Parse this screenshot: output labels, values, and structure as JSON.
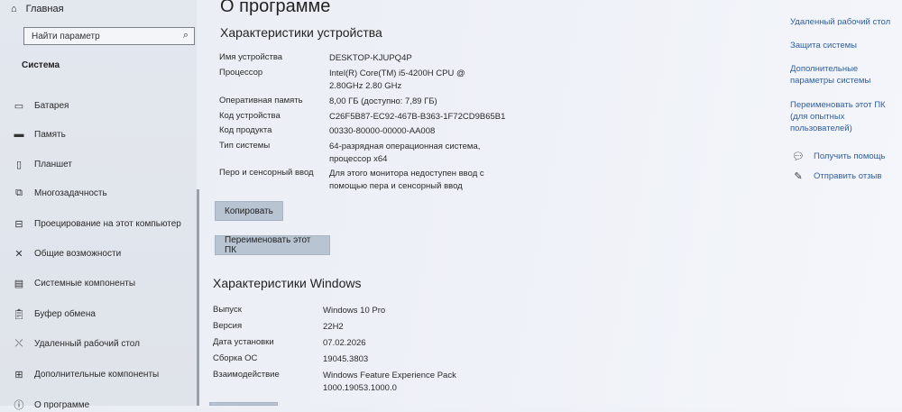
{
  "sidebar": {
    "home_label": "Главная",
    "search_placeholder": "Найти параметр",
    "section_title": "Система",
    "items": [
      {
        "label": "Батарея",
        "icon": "battery-icon"
      },
      {
        "label": "Память",
        "icon": "storage-icon"
      },
      {
        "label": "Планшет",
        "icon": "tablet-icon"
      },
      {
        "label": "Многозадачность",
        "icon": "multitasking-icon"
      },
      {
        "label": "Проецирование на этот компьютер",
        "icon": "projecting-icon"
      },
      {
        "label": "Общие возможности",
        "icon": "shared-experiences-icon"
      },
      {
        "label": "Системные компоненты",
        "icon": "system-components-icon"
      },
      {
        "label": "Буфер обмена",
        "icon": "clipboard-icon"
      },
      {
        "label": "Удаленный рабочий стол",
        "icon": "remote-desktop-icon"
      },
      {
        "label": "Дополнительные компоненты",
        "icon": "optional-features-icon"
      },
      {
        "label": "О программе",
        "icon": "info-icon"
      }
    ]
  },
  "main": {
    "page_title": "О программе",
    "device_specs_title": "Характеристики устройства",
    "device_specs": [
      {
        "key": "Имя устройства",
        "value": "DESKTOP-KJUPQ4P"
      },
      {
        "key": "Процессор",
        "value": "Intel(R) Core(TM) i5-4200H CPU @ 2.80GHz   2.80 GHz"
      },
      {
        "key": "Оперативная память",
        "value": "8,00 ГБ (доступно: 7,89 ГБ)"
      },
      {
        "key": "Код устройства",
        "value": "C26F5B87-EC92-467B-B363-1F72CD9B65B1"
      },
      {
        "key": "Код продукта",
        "value": "00330-80000-00000-AA008"
      },
      {
        "key": "Тип системы",
        "value": "64-разрядная операционная система, процессор x64"
      },
      {
        "key": "Перо и сенсорный ввод",
        "value": "Для этого монитора недоступен ввод с помощью пера и сенсорный ввод"
      }
    ],
    "copy_button": "Копировать",
    "rename_button": "Переименовать этот ПК",
    "windows_specs_title": "Характеристики Windows",
    "windows_specs": [
      {
        "key": "Выпуск",
        "value": "Windows 10 Pro"
      },
      {
        "key": "Версия",
        "value": "22H2"
      },
      {
        "key": "Дата установки",
        "value": "07.02.2026"
      },
      {
        "key": "Сборка ОС",
        "value": "19045.3803"
      },
      {
        "key": "Взаимодействие",
        "value": "Windows Feature Experience Pack 1000.19053.1000.0"
      }
    ]
  },
  "right_panel": {
    "links": [
      "Удаленный рабочий стол",
      "Защита системы",
      "Дополнительные параметры системы",
      "Переименовать этот ПК (для опытных пользователей)"
    ],
    "help": [
      {
        "label": "Получить помощь",
        "icon": "help-chat-icon"
      },
      {
        "label": "Отправить отзыв",
        "icon": "feedback-icon"
      }
    ]
  },
  "colors": {
    "link": "#2f5fa0",
    "button_bg": "#b9c4d3"
  }
}
